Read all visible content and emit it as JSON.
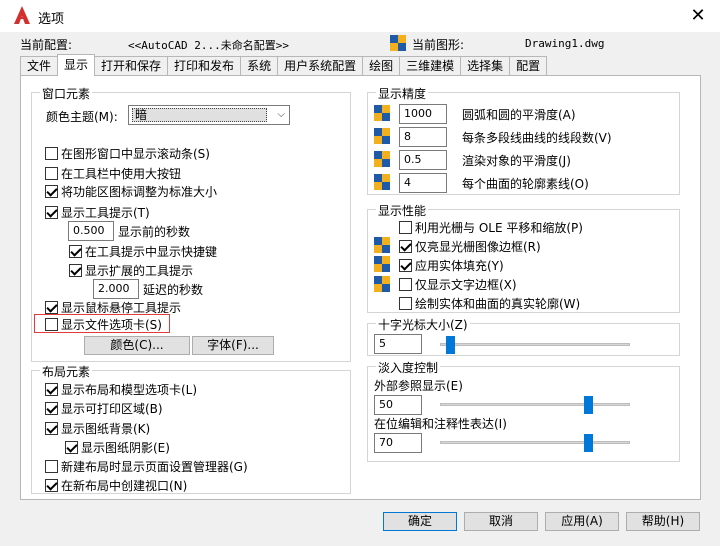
{
  "window": {
    "title": "选项",
    "close_label": "✕"
  },
  "profile": {
    "current_profile_label": "当前配置:",
    "current_profile_value": "<<AutoCAD 2...未命名配置>>",
    "current_drawing_label": "当前图形:",
    "current_drawing_value": "Drawing1.dwg"
  },
  "tabs": [
    {
      "label": "文件",
      "active": false
    },
    {
      "label": "显示",
      "active": true
    },
    {
      "label": "打开和保存",
      "active": false
    },
    {
      "label": "打印和发布",
      "active": false
    },
    {
      "label": "系统",
      "active": false
    },
    {
      "label": "用户系统配置",
      "active": false
    },
    {
      "label": "绘图",
      "active": false
    },
    {
      "label": "三维建模",
      "active": false
    },
    {
      "label": "选择集",
      "active": false
    },
    {
      "label": "配置",
      "active": false
    }
  ],
  "window_elements": {
    "title": "窗口元素",
    "color_scheme_label": "颜色主题(M):",
    "color_scheme_value": "暗",
    "options": [
      {
        "label": "在图形窗口中显示滚动条(S)",
        "checked": false
      },
      {
        "label": "在工具栏中使用大按钮",
        "checked": false
      },
      {
        "label": "将功能区图标调整为标准大小",
        "checked": true
      },
      {
        "label": "显示工具提示(T)",
        "checked": true
      }
    ],
    "delay_before_value": "0.500",
    "delay_before_label": "显示前的秒数",
    "show_shortcut_label": "在工具提示中显示快捷键",
    "show_shortcut_checked": true,
    "show_extended_label": "显示扩展的工具提示",
    "show_extended_checked": true,
    "extended_delay_value": "2.000",
    "extended_delay_label": "延迟的秒数",
    "rollover_label": "显示鼠标悬停工具提示",
    "rollover_checked": true,
    "file_tabs_label": "显示文件选项卡(S)",
    "file_tabs_checked": false,
    "colors_button": "颜色(C)...",
    "fonts_button": "字体(F)..."
  },
  "layout_elements": {
    "title": "布局元素",
    "options": [
      {
        "label": "显示布局和模型选项卡(L)",
        "checked": true
      },
      {
        "label": "显示可打印区域(B)",
        "checked": true
      },
      {
        "label": "显示图纸背景(K)",
        "checked": true
      }
    ],
    "paper_shadow_label": "显示图纸阴影(E)",
    "paper_shadow_checked": true,
    "options2": [
      {
        "label": "新建布局时显示页面设置管理器(G)",
        "checked": false
      },
      {
        "label": "在新布局中创建视口(N)",
        "checked": true
      }
    ]
  },
  "display_resolution": {
    "title": "显示精度",
    "items": [
      {
        "value": "1000",
        "label": "圆弧和圆的平滑度(A)"
      },
      {
        "value": "8",
        "label": "每条多段线曲线的线段数(V)"
      },
      {
        "value": "0.5",
        "label": "渲染对象的平滑度(J)"
      },
      {
        "value": "4",
        "label": "每个曲面的轮廓素线(O)"
      }
    ]
  },
  "display_performance": {
    "title": "显示性能",
    "items": [
      {
        "label": "利用光栅与 OLE 平移和缩放(P)",
        "checked": false,
        "icon": false
      },
      {
        "label": "仅亮显光栅图像边框(R)",
        "checked": true,
        "icon": true
      },
      {
        "label": "应用实体填充(Y)",
        "checked": true,
        "icon": true
      },
      {
        "label": "仅显示文字边框(X)",
        "checked": false,
        "icon": true
      },
      {
        "label": "绘制实体和曲面的真实轮廓(W)",
        "checked": false,
        "icon": false
      }
    ]
  },
  "crosshair": {
    "title": "十字光标大小(Z)",
    "value": "5",
    "level": 0.05
  },
  "fade_control": {
    "title": "淡入度控制",
    "xref_label": "外部参照显示(E)",
    "xref_value": "50",
    "xref_level": 0.78,
    "inplace_label": "在位编辑和注释性表达(I)",
    "inplace_value": "70",
    "inplace_level": 0.78
  },
  "footer": {
    "ok": "确定",
    "cancel": "取消",
    "apply": "应用(A)",
    "help": "帮助(H)"
  },
  "colors": {
    "accent": "#0078d7",
    "highlight_box": "#e23b3b",
    "app_red": "#d32f2f"
  },
  "icons": {
    "app": "autocad-logo-icon",
    "drawing": "drawing-icon",
    "precision": "display-quality-icon"
  }
}
